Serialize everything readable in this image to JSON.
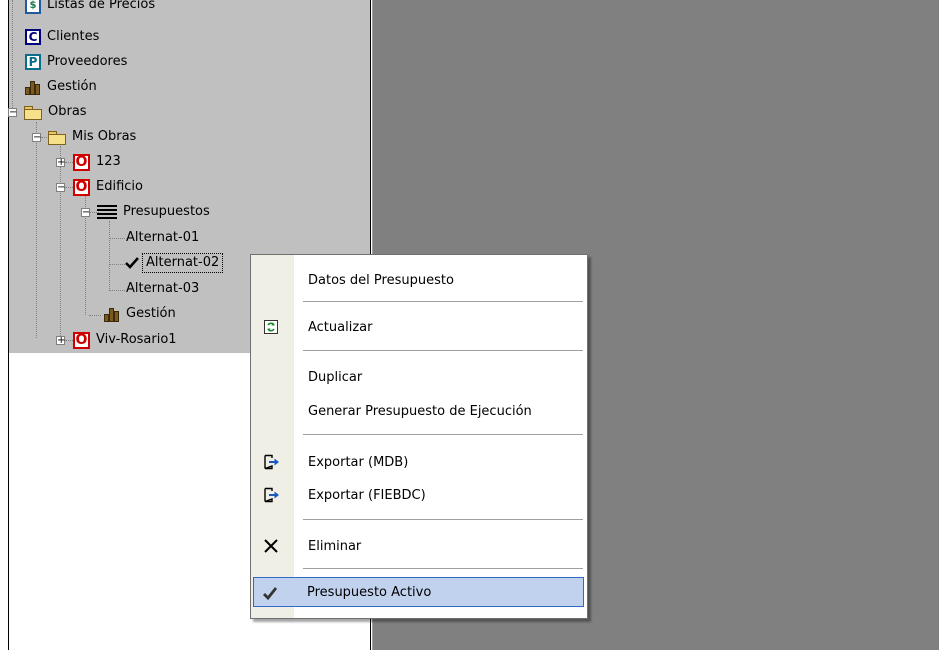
{
  "tree": {
    "items": [
      {
        "label": "Listas de Precios",
        "icon": "dollar-icon"
      },
      {
        "label": "Clientes",
        "icon": "clients-icon"
      },
      {
        "label": "Proveedores",
        "icon": "providers-icon"
      },
      {
        "label": "Gestión",
        "icon": "gestion-icon"
      },
      {
        "label": "Obras",
        "icon": "folder-icon"
      },
      {
        "label": "Mis Obras",
        "icon": "folder-icon"
      },
      {
        "label": "123",
        "icon": "obra-icon"
      },
      {
        "label": "Edificio",
        "icon": "obra-icon"
      },
      {
        "label": "Presupuestos",
        "icon": "list-icon"
      },
      {
        "label": "Alternat-01"
      },
      {
        "label": "Alternat-02",
        "icon": "check-icon",
        "selected": true
      },
      {
        "label": "Alternat-03"
      },
      {
        "label": "Gestión",
        "icon": "gestion-icon"
      },
      {
        "label": "Viv-Rosario1",
        "icon": "obra-icon"
      }
    ],
    "icon_letters": {
      "listas": "$",
      "clientes": "C",
      "proveedores": "P",
      "obra": "O"
    },
    "expander_minus": "−",
    "expander_plus": "+"
  },
  "context_menu": {
    "items": [
      {
        "label": "Datos del Presupuesto"
      },
      {
        "label": "Actualizar",
        "icon": "refresh-icon"
      },
      {
        "label": "Duplicar"
      },
      {
        "label": "Generar Presupuesto de Ejecución"
      },
      {
        "label": "Exportar (MDB)",
        "icon": "export-icon"
      },
      {
        "label": "Exportar (FIEBDC)",
        "icon": "export-icon"
      },
      {
        "label": "Eliminar",
        "icon": "close-icon"
      },
      {
        "label": "Presupuesto Activo",
        "icon": "check-icon",
        "highlighted": true
      }
    ]
  },
  "colors": {
    "workspace_bg": "#808080",
    "tree_bg": "#c0c0c0",
    "menu_highlight": "#c1d2ee",
    "menu_highlight_border": "#316ac5",
    "obra_red": "#d00000"
  }
}
